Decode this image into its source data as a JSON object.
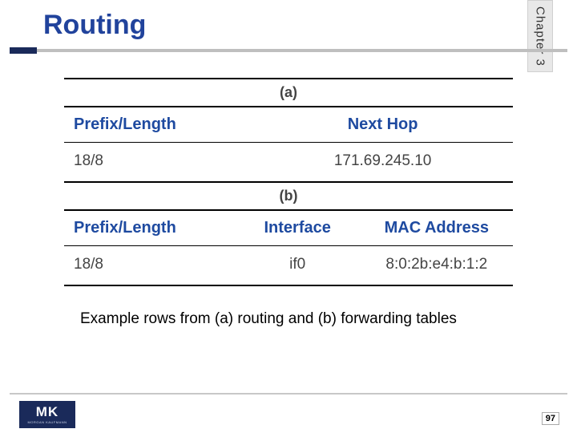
{
  "header": {
    "title": "Routing",
    "chapter_label": "Chapter 3"
  },
  "table_a": {
    "caption": "(a)",
    "headers": [
      "Prefix/Length",
      "Next Hop"
    ],
    "row": [
      "18/8",
      "171.69.245.10"
    ]
  },
  "table_b": {
    "caption": "(b)",
    "headers": [
      "Prefix/Length",
      "Interface",
      "MAC Address"
    ],
    "row": [
      "18/8",
      "if0",
      "8:0:2b:e4:b:1:2"
    ]
  },
  "caption": "Example rows from (a) routing and (b) forwarding tables",
  "footer": {
    "logo_main": "MK",
    "logo_sub": "MORGAN KAUFMANN",
    "page": "97"
  }
}
